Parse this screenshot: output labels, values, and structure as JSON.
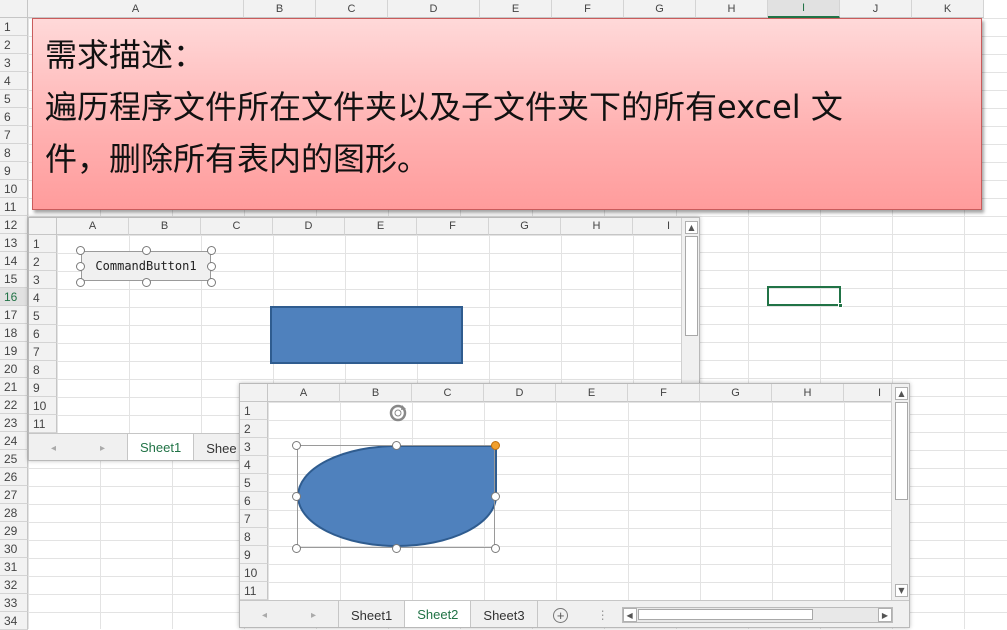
{
  "main_sheet": {
    "columns": [
      "A",
      "B",
      "C",
      "D",
      "E",
      "F",
      "G",
      "H",
      "I",
      "J",
      "K"
    ],
    "rows": [
      "1",
      "2",
      "3",
      "4",
      "5",
      "6",
      "7",
      "8",
      "9",
      "10",
      "11",
      "12",
      "13",
      "14",
      "15",
      "16",
      "17",
      "18",
      "19",
      "20",
      "21",
      "22",
      "23",
      "24",
      "25",
      "26",
      "27",
      "28",
      "29",
      "30",
      "31",
      "32",
      "33",
      "34"
    ],
    "selected_column": "I",
    "selected_row": "16"
  },
  "note": {
    "line1": "需求描述：",
    "line2": "遍历程序文件所在文件夹以及子文件夹下的所有excel 文",
    "line3": "件，删除所有表内的图形。"
  },
  "window1": {
    "columns": [
      "A",
      "B",
      "C",
      "D",
      "E",
      "F",
      "G",
      "H",
      "I"
    ],
    "rows": [
      "1",
      "2",
      "3",
      "4",
      "5",
      "6",
      "7",
      "8",
      "9",
      "10",
      "11"
    ],
    "button_label": "CommandButton1",
    "tabs": [
      "Sheet1",
      "Shee"
    ],
    "rectangle_color": "#4f81bd"
  },
  "window2": {
    "columns": [
      "A",
      "B",
      "C",
      "D",
      "E",
      "F",
      "G",
      "H",
      "I"
    ],
    "rows": [
      "1",
      "2",
      "3",
      "4",
      "5",
      "6",
      "7",
      "8",
      "9",
      "10",
      "11"
    ],
    "tabs": [
      "Sheet1",
      "Sheet2",
      "Sheet3"
    ],
    "active_tab": "Sheet2",
    "add_sheet_icon": "plus-circle-icon",
    "shape_color": "#4f81bd",
    "corner_handle_color": "#f0a030"
  },
  "colors": {
    "accent": "#217346",
    "note_bg": "#ffb0b0",
    "shape_fill": "#4f81bd",
    "tab_underline_red": "#e03030"
  }
}
